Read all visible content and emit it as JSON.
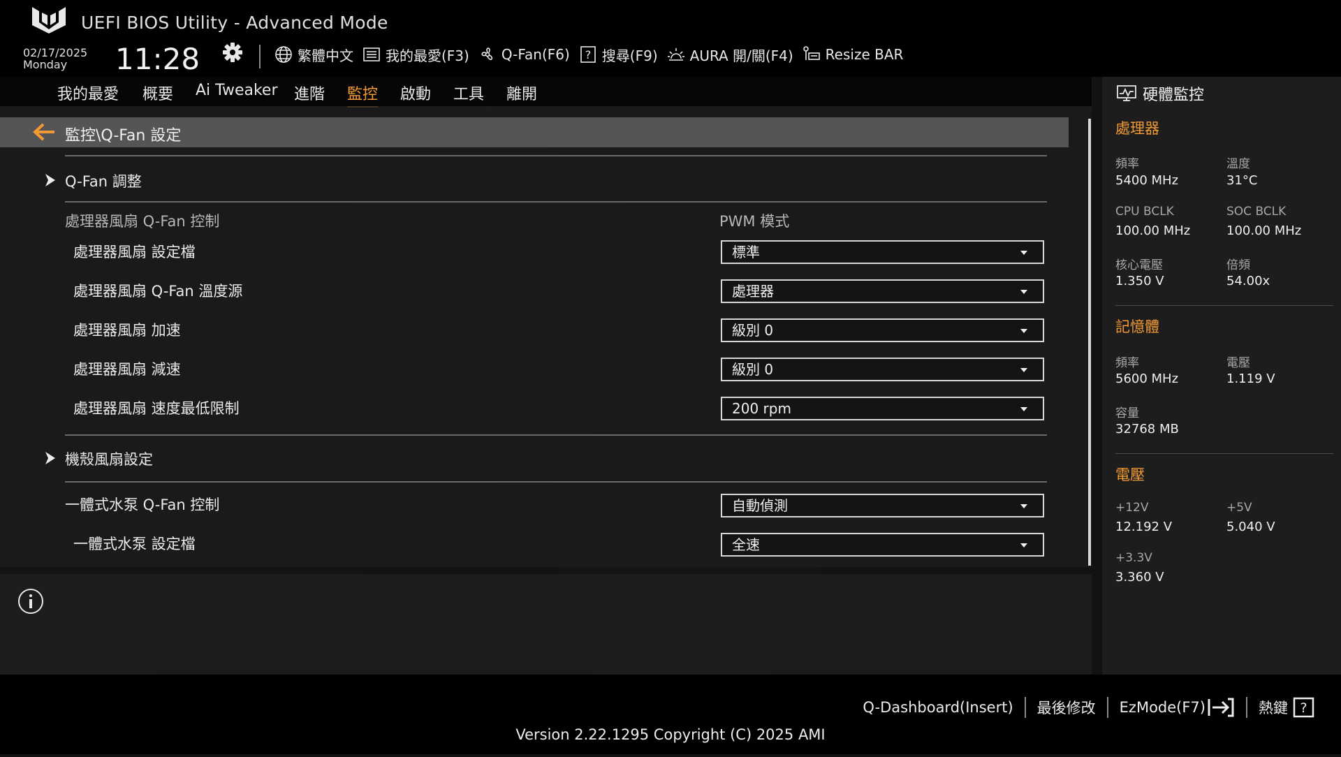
{
  "header": {
    "title": "UEFI BIOS Utility - Advanced Mode",
    "date": "02/17/2025",
    "day": "Monday",
    "time": "11:28",
    "tools": [
      {
        "label": "繁體中文",
        "icon": "globe-icon"
      },
      {
        "label": "我的最愛(F3)",
        "icon": "favorites-icon"
      },
      {
        "label": "Q-Fan(F6)",
        "icon": "fan-icon"
      },
      {
        "label": "搜尋(F9)",
        "icon": "search-help-icon"
      },
      {
        "label": "AURA 開/關(F4)",
        "icon": "aura-icon"
      },
      {
        "label": "Resize BAR",
        "icon": "resize-bar-icon"
      }
    ]
  },
  "nav": {
    "tabs": [
      "我的最愛",
      "概要",
      "Ai Tweaker",
      "進階",
      "監控",
      "啟動",
      "工具",
      "離開"
    ],
    "active": "監控"
  },
  "main": {
    "breadcrumb": "監控\\Q-Fan 設定",
    "qfan_tuning": "Q-Fan 調整",
    "cpu_fan_control": {
      "label": "處理器風扇 Q-Fan 控制",
      "value": "PWM 模式"
    },
    "settings": [
      {
        "label": "處理器風扇 設定檔",
        "value": "標準"
      },
      {
        "label": "處理器風扇 Q-Fan 溫度源",
        "value": "處理器"
      },
      {
        "label": "處理器風扇 加速",
        "value": "級別 0"
      },
      {
        "label": "處理器風扇 減速",
        "value": "級別 0"
      },
      {
        "label": "處理器風扇 速度最低限制",
        "value": "200 rpm"
      }
    ],
    "chassis_fan": "機殼風扇設定",
    "aio_pump_control": {
      "label": "一體式水泵 Q-Fan 控制",
      "value": "自動偵測"
    },
    "aio_pump_profile": {
      "label": "一體式水泵 設定檔",
      "value": "全速"
    }
  },
  "monitor": {
    "title": "硬體監控",
    "cpu": {
      "title": "處理器",
      "freq_label": "頻率",
      "freq": "5400 MHz",
      "temp_label": "溫度",
      "temp": "31°C",
      "bclk_label": "CPU BCLK",
      "bclk": "100.00 MHz",
      "soc_label": "SOC BCLK",
      "soc": "100.00 MHz",
      "vcore_label": "核心電壓",
      "vcore": "1.350 V",
      "ratio_label": "倍頻",
      "ratio": "54.00x"
    },
    "memory": {
      "title": "記憶體",
      "freq_label": "頻率",
      "freq": "5600 MHz",
      "volt_label": "電壓",
      "volt": "1.119 V",
      "cap_label": "容量",
      "cap": "32768 MB"
    },
    "voltage": {
      "title": "電壓",
      "v12_label": "+12V",
      "v12": "12.192 V",
      "v5_label": "+5V",
      "v5": "5.040 V",
      "v33_label": "+3.3V",
      "v33": "3.360 V"
    }
  },
  "footer": {
    "qdashboard": "Q-Dashboard(Insert)",
    "last_modified": "最後修改",
    "ezmode": "EzMode(F7)",
    "hotkeys": "熱鍵",
    "version": "Version 2.22.1295 Copyright (C) 2025 AMI"
  },
  "colors": {
    "accent": "#f29b35",
    "background": "#121212",
    "panel": "#1d1d1e"
  }
}
